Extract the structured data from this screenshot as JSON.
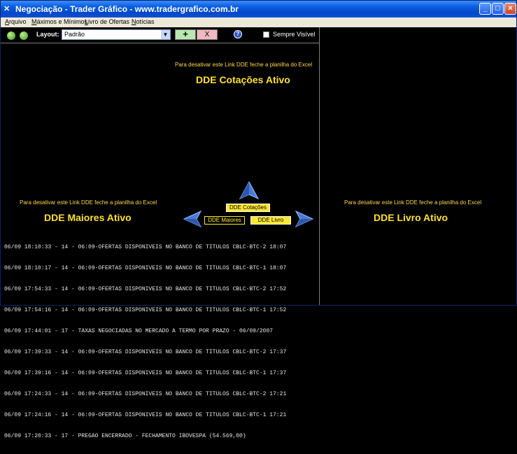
{
  "window": {
    "title": "Negociação - Trader Gráfico - www.tradergrafico.com.br",
    "minimize": "_",
    "maximize": "□",
    "close": "×"
  },
  "menu": [
    "Arquivo",
    "Máximos e Mínimos",
    "Livro de Ofertas",
    "Notícias"
  ],
  "toolbar": {
    "layout_label": "Layout:",
    "layout_value": "Padrão",
    "add_label": "+",
    "remove_label": "X",
    "help_label": "?",
    "always_visible_label": "Sempre Visível",
    "always_visible_checked": false
  },
  "panels": {
    "cotacoes": {
      "hint": "Para desativar este Link DDE feche a planilha do Excel",
      "title": "DDE Cotações Ativo"
    },
    "maiores": {
      "hint": "Para desativar este Link DDE feche a planilha do Excel",
      "title": "DDE Maiores Ativo"
    },
    "livro": {
      "hint": "Para desativar este Link DDE feche a planilha do Excel",
      "title": "DDE Livro Ativo"
    }
  },
  "nav": {
    "cotacoes": "DDE Cotações",
    "maiores": "DDE Maiores",
    "livro": "DDE Livro"
  },
  "log": [
    "06/09 18:10:33 - 14 - 06:09-OFERTAS DISPONIVEIS NO BANCO DE TITULOS CBLC-BTC-2 18:07",
    "06/09 18:10:17 - 14 - 06:09-OFERTAS DISPONIVEIS NO BANCO DE TITULOS CBLC-BTC-1 18:07",
    "06/09 17:54:33 - 14 - 06:09-OFERTAS DISPONIVEIS NO BANCO DE TITULOS CBLC-BTC-2 17:52",
    "06/09 17:54:16 - 14 - 06:09-OFERTAS DISPONIVEIS NO BANCO DE TITULOS CBLC-BTC-1 17:52",
    "06/09 17:44:01 - 17 - TAXAS NEGOCIADAS NO MERCADO A TERMO POR PRAZO - 06/09/2007",
    "06/09 17:39:33 - 14 - 06:09-OFERTAS DISPONIVEIS NO BANCO DE TITULOS CBLC-BTC-2 17:37",
    "06/09 17:39:16 - 14 - 06:09-OFERTAS DISPONIVEIS NO BANCO DE TITULOS CBLC-BTC-1 17:37",
    "06/09 17:24:33 - 14 - 06:09-OFERTAS DISPONIVEIS NO BANCO DE TITULOS CBLC-BTC-2 17:21",
    "06/09 17:24:16 - 14 - 06:09-OFERTAS DISPONIVEIS NO BANCO DE TITULOS CBLC-BTC-1 17:21",
    "06/09 17:20:33 - 17 - PREGAO ENCERRADO - FECHAMENTO IBOVESPA (54.569,00)"
  ],
  "colors": {
    "accent": "#ffe030",
    "background": "#000000",
    "arrow": "#4a7ad8"
  }
}
